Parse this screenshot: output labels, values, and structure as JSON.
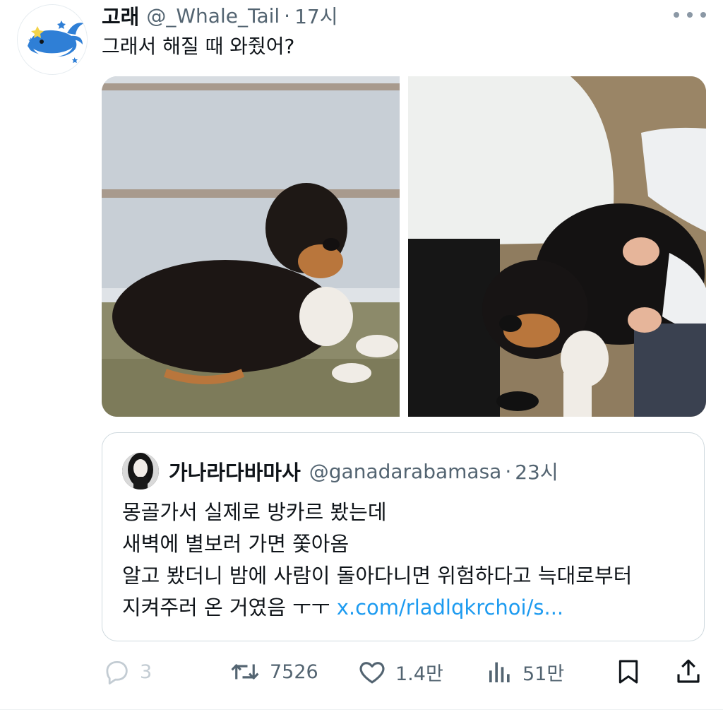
{
  "tweet": {
    "author_name": "고래",
    "author_handle": "@_Whale_Tail",
    "separator": "·",
    "time": "17시",
    "text": "그래서 해질 때 와줬어?"
  },
  "media": {
    "photos": [
      {
        "icon": "dog-lying-photo"
      },
      {
        "icon": "dog-being-petted-photo"
      }
    ]
  },
  "quote": {
    "author_name": "가나라다바마사",
    "author_handle": "@ganadarabamasa",
    "separator": "·",
    "time": "23시",
    "lines": [
      "몽골가서 실제로 방카르 봤는데",
      "새벽에 별보러 가면 쫓아옴",
      "알고 봤더니 밤에 사람이 돌아다니면 위험하다고 늑대로부터"
    ],
    "last_line_text": "지켜주러 온 거였음 ㅜㅜ ",
    "link": "x.com/rladlqkrchoi/s..."
  },
  "actions": {
    "reply_count": "3",
    "retweet_count": "7526",
    "like_count": "1.4만",
    "views_count": "51만"
  },
  "colors": {
    "text": "#0f1419",
    "secondary": "#536471",
    "link": "#1d9bf0",
    "border": "#cfd9de"
  }
}
